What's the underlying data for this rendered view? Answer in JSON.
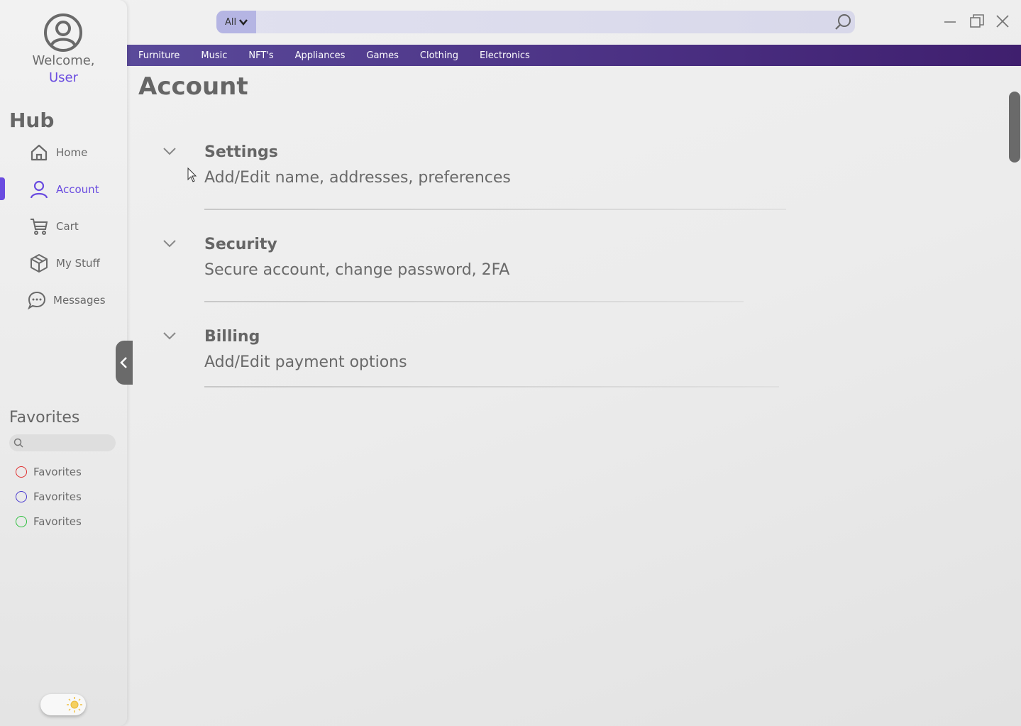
{
  "sidebar": {
    "welcome": "Welcome,",
    "user": "User",
    "hub_title": "Hub",
    "nav": [
      {
        "label": "Home",
        "icon": "home-icon"
      },
      {
        "label": "Account",
        "icon": "user-icon",
        "active": true
      },
      {
        "label": "Cart",
        "icon": "cart-icon"
      },
      {
        "label": "My Stuff",
        "icon": "box-icon"
      },
      {
        "label": "Messages",
        "icon": "chat-icon"
      }
    ],
    "favorites_title": "Favorites",
    "favorites_search_placeholder": "",
    "favorites": [
      {
        "label": "Favorites",
        "color": "#e03030"
      },
      {
        "label": "Favorites",
        "color": "#4a3ad0"
      },
      {
        "label": "Favorites",
        "color": "#30c040"
      }
    ]
  },
  "search": {
    "category": "All",
    "placeholder": ""
  },
  "categories": [
    "Furniture",
    "Music",
    "NFT's",
    "Appliances",
    "Games",
    "Clothing",
    "Electronics"
  ],
  "main": {
    "title": "Account",
    "sections": [
      {
        "title": "Settings",
        "desc": "Add/Edit name, addresses, preferences"
      },
      {
        "title": "Security",
        "desc": "Secure account, change password, 2FA"
      },
      {
        "title": "Billing",
        "desc": "Add/Edit payment options"
      }
    ]
  },
  "colors": {
    "accent": "#6a4ce0",
    "nav_bar": "#4a2f82"
  }
}
